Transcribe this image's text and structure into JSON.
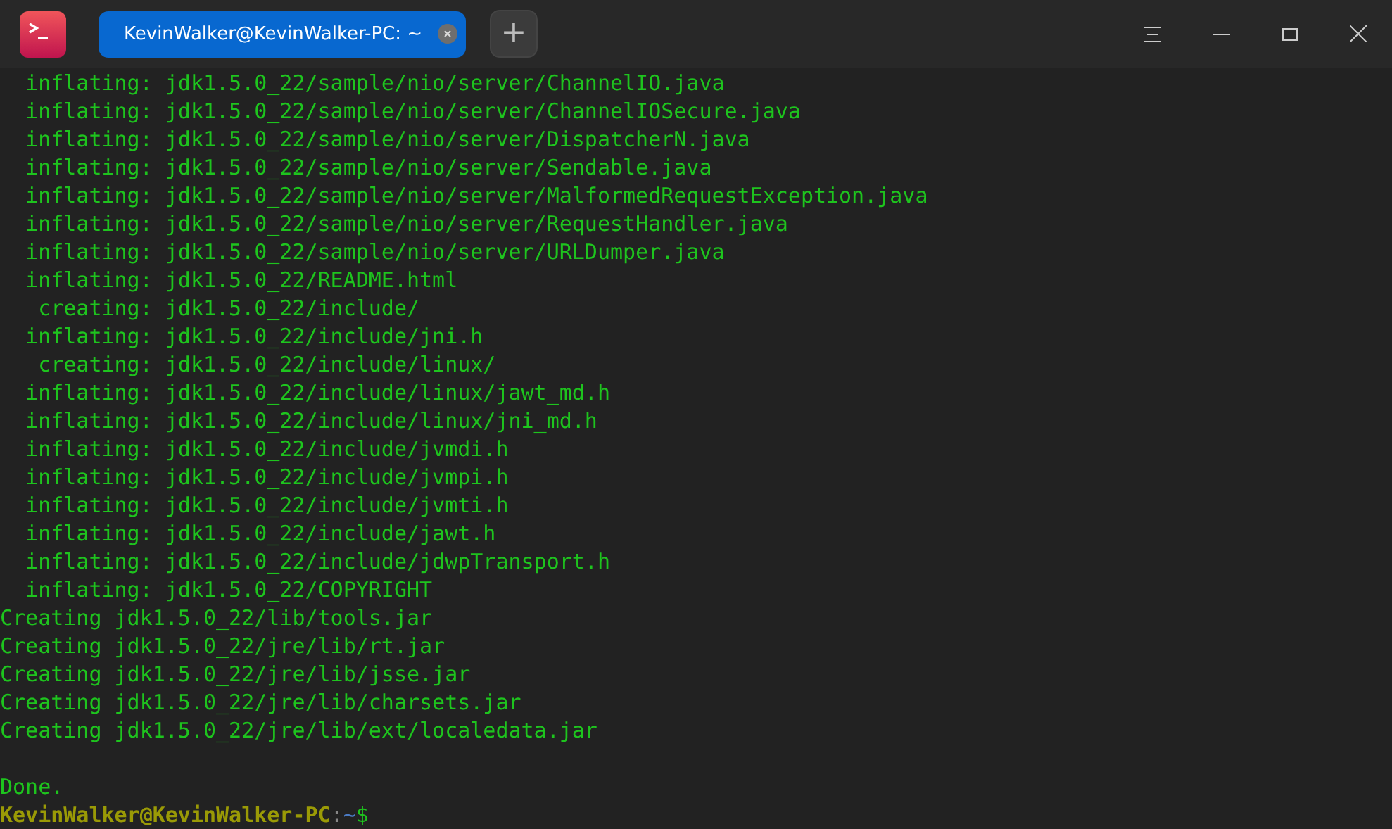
{
  "window": {
    "tabs": [
      {
        "label": "KevinWalker@KevinWalker-PC: ~",
        "selected": true
      }
    ],
    "new_tab_label": "+"
  },
  "terminal": {
    "lines": [
      {
        "kind": "output",
        "text": "  inflating: jdk1.5.0_22/sample/nio/server/ChannelIO.java"
      },
      {
        "kind": "output",
        "text": "  inflating: jdk1.5.0_22/sample/nio/server/ChannelIOSecure.java"
      },
      {
        "kind": "output",
        "text": "  inflating: jdk1.5.0_22/sample/nio/server/DispatcherN.java"
      },
      {
        "kind": "output",
        "text": "  inflating: jdk1.5.0_22/sample/nio/server/Sendable.java"
      },
      {
        "kind": "output",
        "text": "  inflating: jdk1.5.0_22/sample/nio/server/MalformedRequestException.java"
      },
      {
        "kind": "output",
        "text": "  inflating: jdk1.5.0_22/sample/nio/server/RequestHandler.java"
      },
      {
        "kind": "output",
        "text": "  inflating: jdk1.5.0_22/sample/nio/server/URLDumper.java"
      },
      {
        "kind": "output",
        "text": "  inflating: jdk1.5.0_22/README.html"
      },
      {
        "kind": "output",
        "text": "   creating: jdk1.5.0_22/include/"
      },
      {
        "kind": "output",
        "text": "  inflating: jdk1.5.0_22/include/jni.h"
      },
      {
        "kind": "output",
        "text": "   creating: jdk1.5.0_22/include/linux/"
      },
      {
        "kind": "output",
        "text": "  inflating: jdk1.5.0_22/include/linux/jawt_md.h"
      },
      {
        "kind": "output",
        "text": "  inflating: jdk1.5.0_22/include/linux/jni_md.h"
      },
      {
        "kind": "output",
        "text": "  inflating: jdk1.5.0_22/include/jvmdi.h"
      },
      {
        "kind": "output",
        "text": "  inflating: jdk1.5.0_22/include/jvmpi.h"
      },
      {
        "kind": "output",
        "text": "  inflating: jdk1.5.0_22/include/jvmti.h"
      },
      {
        "kind": "output",
        "text": "  inflating: jdk1.5.0_22/include/jawt.h"
      },
      {
        "kind": "output",
        "text": "  inflating: jdk1.5.0_22/include/jdwpTransport.h"
      },
      {
        "kind": "output",
        "text": "  inflating: jdk1.5.0_22/COPYRIGHT"
      },
      {
        "kind": "output",
        "text": "Creating jdk1.5.0_22/lib/tools.jar"
      },
      {
        "kind": "output",
        "text": "Creating jdk1.5.0_22/jre/lib/rt.jar"
      },
      {
        "kind": "output",
        "text": "Creating jdk1.5.0_22/jre/lib/jsse.jar"
      },
      {
        "kind": "output",
        "text": "Creating jdk1.5.0_22/jre/lib/charsets.jar"
      },
      {
        "kind": "output",
        "text": "Creating jdk1.5.0_22/jre/lib/ext/localedata.jar"
      },
      {
        "kind": "blank"
      },
      {
        "kind": "output",
        "text": "Done."
      }
    ],
    "prompt": {
      "user_host": "KevinWalker@KevinWalker-PC",
      "separator": ":",
      "path": "~",
      "symbol": "$"
    }
  }
}
